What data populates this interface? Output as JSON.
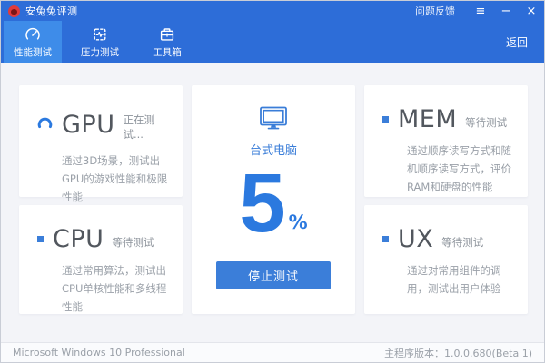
{
  "window": {
    "title": "安兔兔评测",
    "controls": {
      "menu": "≡",
      "minimize": "−",
      "close": "×"
    },
    "feedback": "问题反馈"
  },
  "navbar": {
    "tabs": [
      {
        "label": "性能测试",
        "icon": "gauge-icon",
        "active": true
      },
      {
        "label": "压力测试",
        "icon": "chip-icon",
        "active": false
      },
      {
        "label": "工具箱",
        "icon": "toolbox-icon",
        "active": false
      }
    ],
    "back_label": "返回"
  },
  "cards": {
    "gpu": {
      "title": "GPU",
      "status": "正在测试...",
      "desc": "通过3D场景，测试出GPU的游戏性能和极限性能"
    },
    "cpu": {
      "title": "CPU",
      "status": "等待测试",
      "desc": "通过常用算法，测试出CPU单核性能和多线程性能"
    },
    "mem": {
      "title": "MEM",
      "status": "等待测试",
      "desc": "通过顺序读写方式和随机顺序读写方式，评价RAM和硬盘的性能"
    },
    "ux": {
      "title": "UX",
      "status": "等待测试",
      "desc": "通过对常用组件的调用，测试出用户体验"
    }
  },
  "progress": {
    "device": "台式电脑",
    "percent": "5",
    "percent_sign": "%",
    "stop_label": "停止测试"
  },
  "statusbar": {
    "os": "Microsoft Windows 10 Professional",
    "version": "主程序版本：1.0.0.680(Beta 1)"
  },
  "colors": {
    "header_blue": "#2d6dd8",
    "active_tab_blue": "#3e8ce9",
    "accent_blue": "#2b79df",
    "button_blue": "#3b7ed9",
    "logo_red": "#e03b3b",
    "content_bg": "#f3f4f8"
  }
}
